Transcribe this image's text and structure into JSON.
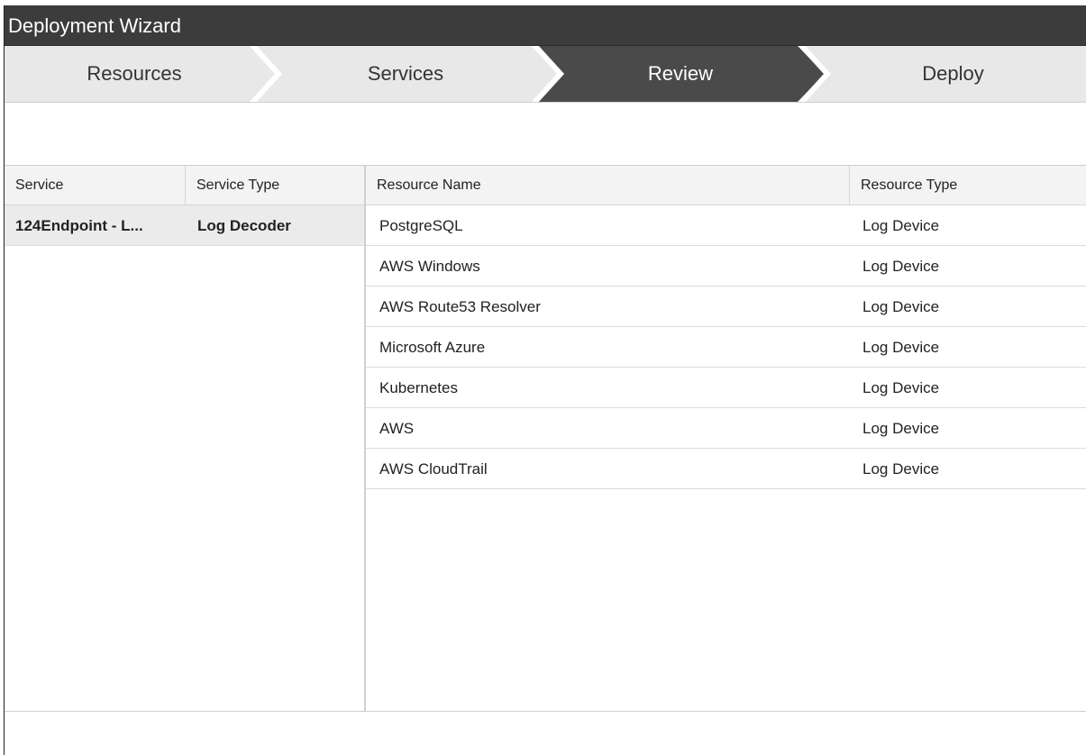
{
  "window": {
    "title": "Deployment Wizard"
  },
  "steps": [
    {
      "label": "Resources",
      "active": false
    },
    {
      "label": "Services",
      "active": false
    },
    {
      "label": "Review",
      "active": true
    },
    {
      "label": "Deploy",
      "active": false
    }
  ],
  "services_table": {
    "headers": {
      "service": "Service",
      "service_type": "Service Type"
    },
    "rows": [
      {
        "service": "124Endpoint - L...",
        "service_type": "Log Decoder"
      }
    ]
  },
  "resources_table": {
    "headers": {
      "resource_name": "Resource Name",
      "resource_type": "Resource Type"
    },
    "rows": [
      {
        "name": "PostgreSQL",
        "type": "Log Device"
      },
      {
        "name": "AWS Windows",
        "type": "Log Device"
      },
      {
        "name": "AWS Route53 Resolver",
        "type": "Log Device"
      },
      {
        "name": "Microsoft Azure",
        "type": "Log Device"
      },
      {
        "name": "Kubernetes",
        "type": "Log Device"
      },
      {
        "name": "AWS",
        "type": "Log Device"
      },
      {
        "name": "AWS CloudTrail",
        "type": "Log Device"
      }
    ]
  },
  "colors": {
    "titlebar": "#3c3c3c",
    "step_active": "#4a4a4a",
    "step_inactive": "#e8e8e8"
  }
}
